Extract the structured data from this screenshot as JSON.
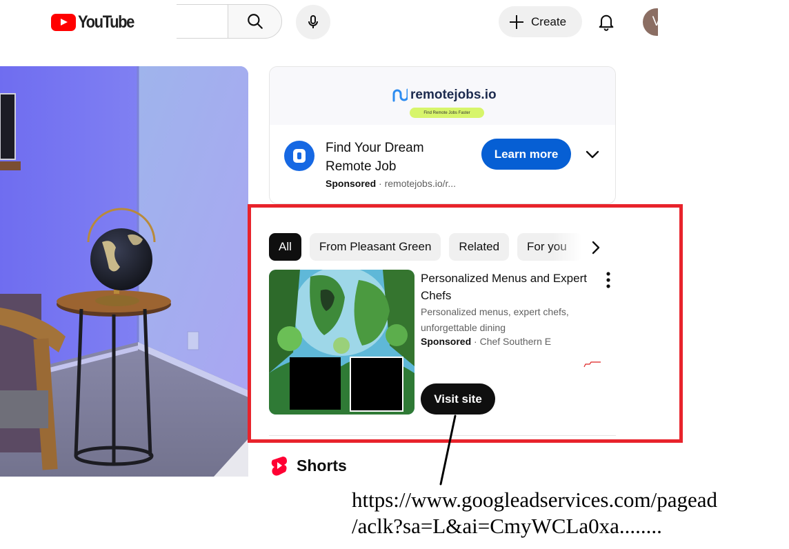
{
  "header": {
    "logo_text": "YouTube",
    "create_label": "Create",
    "avatar_initial": "V"
  },
  "ad": {
    "brand_name": "remotejobs.io",
    "brand_tagline": "Find Remote Jobs Faster",
    "title": "Find Your Dream Remote Job",
    "sponsored_label": "Sponsored",
    "separator": "·",
    "domain": "remotejobs.io/r...",
    "cta_label": "Learn more"
  },
  "chips": [
    {
      "label": "All",
      "active": true
    },
    {
      "label": "From Pleasant Green",
      "active": false
    },
    {
      "label": "Related",
      "active": false
    },
    {
      "label": "For you",
      "active": false
    }
  ],
  "sponsored_item": {
    "title": "Personalized Menus and Expert Chefs",
    "description": "Personalized menus, expert chefs, unforgettable dining",
    "sponsored_label": "Sponsored",
    "separator": "·",
    "advertiser": "Chef Southern E",
    "cta_label": "Visit site"
  },
  "shorts": {
    "label": "Shorts"
  },
  "annotation": {
    "url_line1": "https://www.googleadservices.com/pagead",
    "url_line2": "/aclk?sa=L&ai=CmyWCLa0xa........"
  },
  "colors": {
    "youtube_red": "#ff0000",
    "highlight_red": "#e8232b",
    "learn_more_blue": "#065fd4",
    "chip_active": "#0f0f0f",
    "chip_inactive": "#f0f0f0"
  }
}
